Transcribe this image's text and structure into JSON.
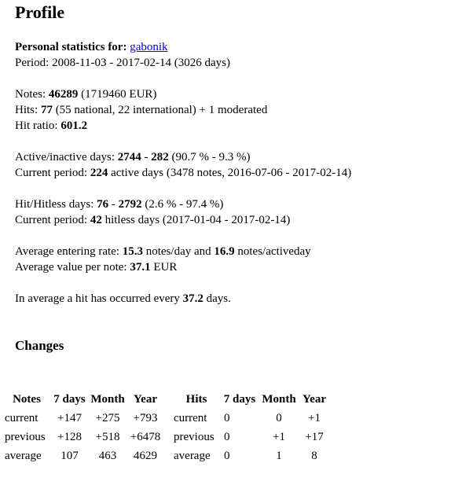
{
  "title": "Profile",
  "personal": {
    "label": "Personal statistics for:",
    "username": "gabonik",
    "period_label": "Period:",
    "period_value": "2008-11-03 - 2017-02-14 (3026 days)"
  },
  "notes": {
    "label": "Notes:",
    "count": "46289",
    "value": "(1719460 EUR)"
  },
  "hits": {
    "label": "Hits:",
    "count": "77",
    "detail": "(55 national, 22 international) + 1 moderated"
  },
  "hit_ratio": {
    "label": "Hit ratio:",
    "value": "601.2"
  },
  "active": {
    "label": "Active/inactive days:",
    "active_days": "2744",
    "sep": "-",
    "inactive_days": "282",
    "percent": "(90.7 % - 9.3 %)"
  },
  "current_active": {
    "label": "Current period:",
    "days": "224",
    "rest": "active days (3478 notes, 2016-07-06 - 2017-02-14)"
  },
  "hitless": {
    "label": "Hit/Hitless days:",
    "hit_days": "76",
    "sep": "-",
    "hitless_days": "2792",
    "percent": "(2.6 % - 97.4 %)"
  },
  "current_hitless": {
    "label": "Current period:",
    "days": "42",
    "rest": "hitless days (2017-01-04 - 2017-02-14)"
  },
  "rates": {
    "entering_label": "Average entering rate:",
    "per_day": "15.3",
    "per_day_unit": "notes/day and",
    "per_activeday": "16.9",
    "per_activeday_unit": "notes/activeday",
    "value_label": "Average value per note:",
    "value_per_note": "37.1",
    "value_unit": "EUR"
  },
  "hit_interval": {
    "prefix": "In average a hit has occurred every",
    "days": "37.2",
    "suffix": "days."
  },
  "changes": {
    "title": "Changes",
    "notes_table": {
      "headers": [
        "Notes",
        "7 days",
        "Month",
        "Year"
      ],
      "rows": [
        [
          "current",
          "+147",
          "+275",
          "+793"
        ],
        [
          "previous",
          "+128",
          "+518",
          "+6478"
        ],
        [
          "average",
          "107",
          "463",
          "4629"
        ]
      ]
    },
    "hits_table": {
      "headers": [
        "Hits",
        "7 days",
        "Month",
        "Year"
      ],
      "rows": [
        [
          "current",
          "0",
          "0",
          "+1"
        ],
        [
          "previous",
          "0",
          "+1",
          "+17"
        ],
        [
          "average",
          "0",
          "1",
          "8"
        ]
      ]
    }
  }
}
